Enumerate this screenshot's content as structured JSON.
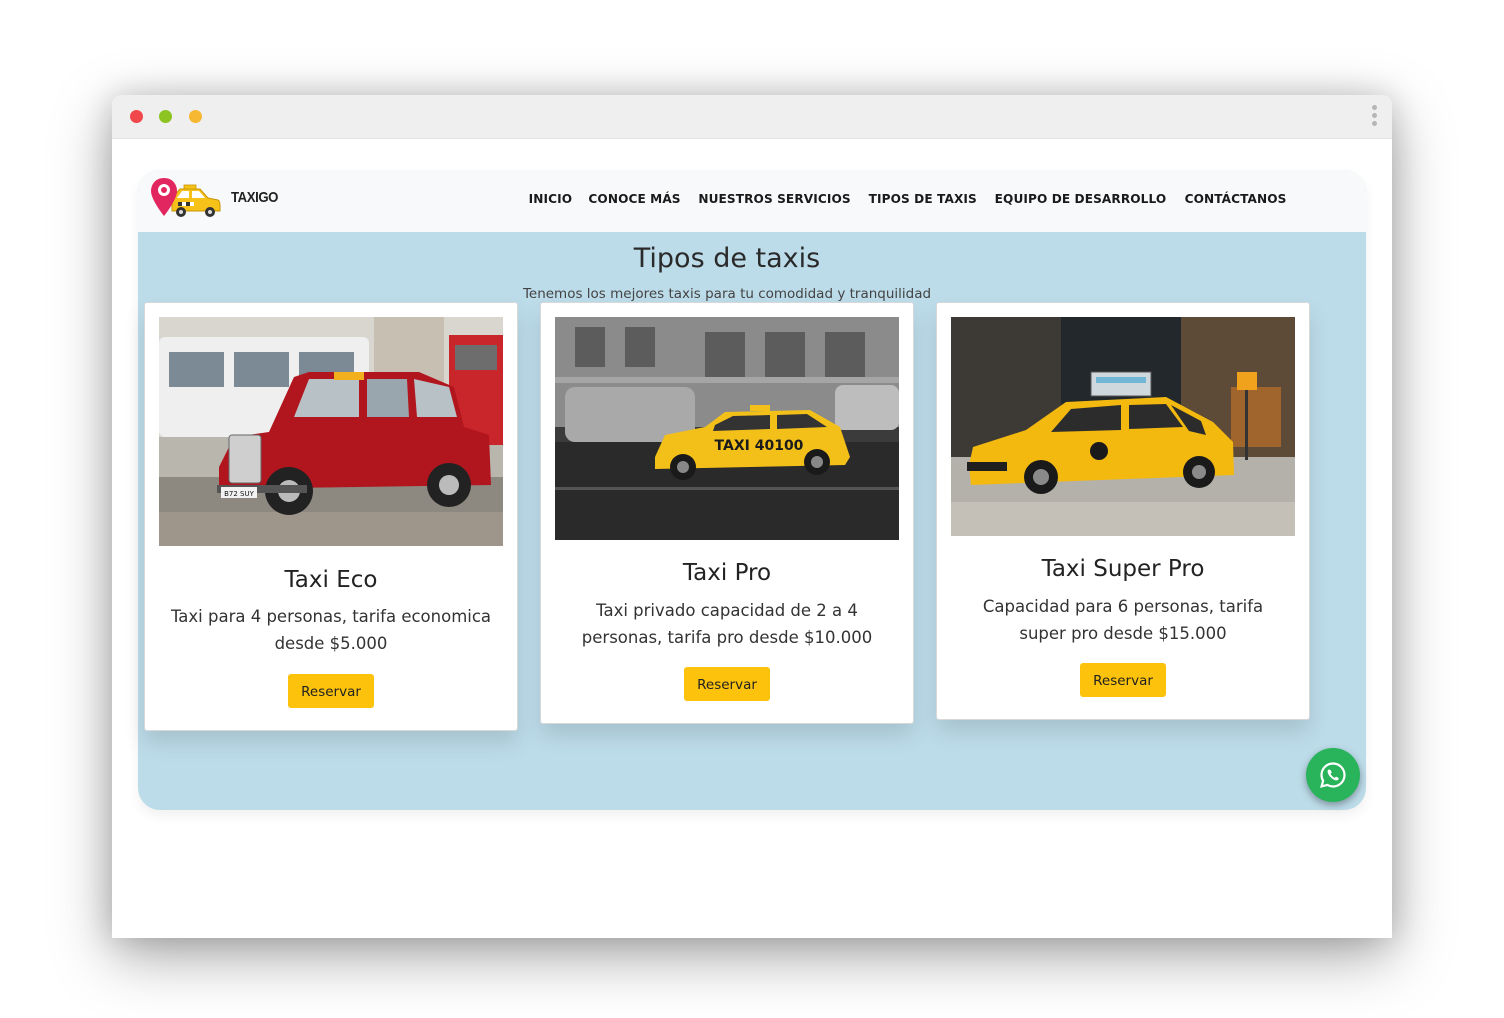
{
  "site": {
    "brand": "TAXIGO",
    "nav": [
      "INICIO",
      "CONOCE MÁS",
      "NUESTROS SERVICIOS",
      "TIPOS DE TAXIS",
      "EQUIPO DE DESARROLLO",
      "CONTÁCTANOS"
    ],
    "heading": "Tipos de taxis",
    "subheading": "Tenemos los mejores taxis para tu comodidad y tranquilidad"
  },
  "cards": [
    {
      "title": "Taxi Eco",
      "text_line1": "Taxi para 4 personas, tarifa economica",
      "text_line2": "desde $5.000",
      "button": "Reservar"
    },
    {
      "title": "Taxi Pro",
      "text_line1": "Taxi privado capacidad de 2 a 4",
      "text_line2": "personas, tarifa pro desde $10.000",
      "button": "Reservar"
    },
    {
      "title": "Taxi Super Pro",
      "text_line1": "Capacidad para 6 personas, tarifa",
      "text_line2": "super pro desde $15.000",
      "button": "Reservar"
    }
  ],
  "images": {
    "card1_plate": "B72 SUY",
    "card2_sign": "TAXI 40100"
  },
  "colors": {
    "accent": "#fcc20c",
    "section_bg": "#bddcea",
    "navbar_bg": "#f8f9fa",
    "whatsapp": "#29b35a"
  },
  "icons": {
    "logo": "taxi-map-pin-logo",
    "whatsapp": "whatsapp-icon",
    "menu": "kebab-menu-icon"
  }
}
